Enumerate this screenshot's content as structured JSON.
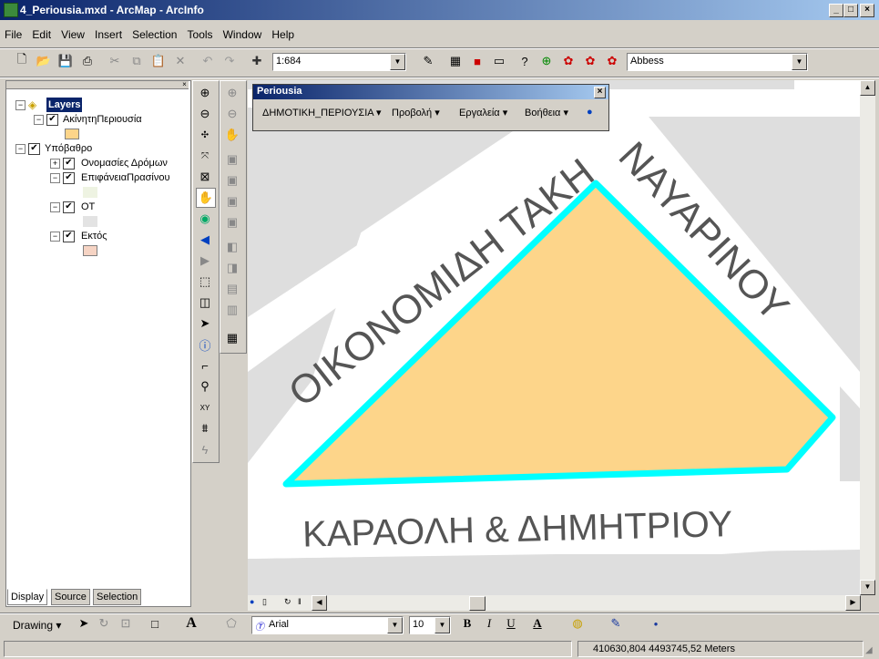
{
  "window": {
    "title": "4_Periousia.mxd - ArcMap - ArcInfo"
  },
  "menus": [
    "File",
    "Edit",
    "View",
    "Insert",
    "Selection",
    "Tools",
    "Window",
    "Help"
  ],
  "standard_toolbar": {
    "scale": "1:684",
    "label_font": "Abbess"
  },
  "toc": {
    "root": "Layers",
    "layers": [
      {
        "name": "ΑκίνητηΠεριουσία",
        "swatch": "#fdd58a"
      },
      {
        "name": "Υπόβαθρο"
      },
      {
        "name": "Ονομασίες Δρόμων"
      },
      {
        "name": "ΕπιφάνειαΠρασίνου",
        "swatch": "#eef3e2"
      },
      {
        "name": "ΟΤ",
        "swatch": "#e3e3e3"
      },
      {
        "name": "Εκτός",
        "swatch": "#f6d4c4"
      }
    ],
    "tabs": [
      "Display",
      "Source",
      "Selection"
    ]
  },
  "floating_toolbar": {
    "title": "Periousia",
    "menus": [
      "ΔΗΜΟΤΙΚΗ_ΠΕΡΙΟΥΣΙΑ",
      "Προβολή",
      "Εργαλεία",
      "Βοήθεια"
    ]
  },
  "map": {
    "labels": [
      "ΟΙΚΟΝΟΜΙΔΗ ΤΑΚΗ",
      "ΝΑΥΑΡΙΝΟΥ",
      "ΚΑΡΑΟΛΗ & ΔΗΜΗΤΡΙΟΥ"
    ],
    "colors": {
      "parcel_fill": "#fdd58a",
      "parcel_outline": "#00ffff",
      "block": "#dedede",
      "road": "#ffffff"
    }
  },
  "drawing_toolbar": {
    "drawing_label": "Drawing",
    "font": "Arial",
    "font_size": "10"
  },
  "status": {
    "coords": "410630,804  4493745,52 Meters"
  }
}
